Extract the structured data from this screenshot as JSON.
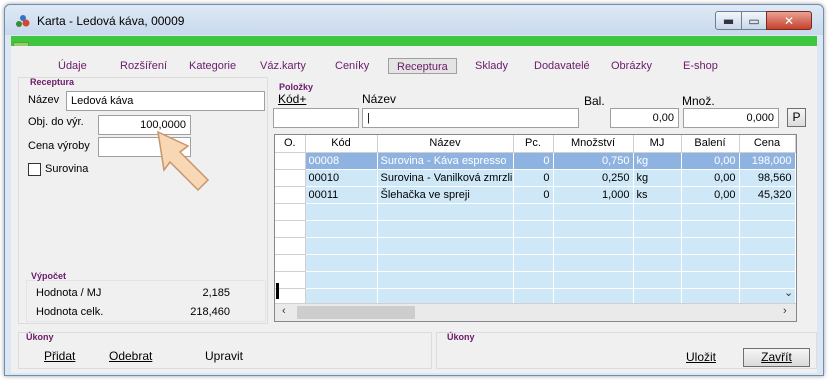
{
  "window": {
    "title": "Karta - Ledová káva, 00009"
  },
  "help_label": "?",
  "tabs": [
    {
      "label": "Údaje"
    },
    {
      "label": "Rozšíření"
    },
    {
      "label": "Kategorie"
    },
    {
      "label": "Váz.karty"
    },
    {
      "label": "Ceníky"
    },
    {
      "label": "Receptura"
    },
    {
      "label": "Sklady"
    },
    {
      "label": "Dodavatelé"
    },
    {
      "label": "Obrázky"
    },
    {
      "label": "E-shop"
    }
  ],
  "receptura": {
    "group_title": "Receptura",
    "nazev_label": "Název",
    "nazev_value": "Ledová káva",
    "obj_label": "Obj. do výr.",
    "obj_value": "100,0000",
    "cena_label": "Cena výroby",
    "cena_value": "",
    "surovina_label": "Surovina"
  },
  "vypocet": {
    "title": "Výpočet",
    "hodnota_mj_label": "Hodnota / MJ",
    "hodnota_mj_value": "2,185",
    "hodnota_celk_label": "Hodnota celk.",
    "hodnota_celk_value": "218,460"
  },
  "polozky": {
    "title": "Položky",
    "kod_label": "Kód+",
    "nazev_label": "Název",
    "bal_label": "Bal.",
    "mnoz_label": "Množ.",
    "kod_value": "",
    "nazev_value": "|",
    "bal_value": "0,00",
    "mnoz_value": "0,000",
    "p_button": "P"
  },
  "grid": {
    "columns": [
      "O.",
      "Kód",
      "Název",
      "Pc.",
      "Množství",
      "MJ",
      "Balení",
      "Cena"
    ],
    "rows": [
      {
        "o": "",
        "kod": "00008",
        "nazev": "Surovina - Káva espresso",
        "pc": "0",
        "mnozstvi": "0,750",
        "mj": "kg",
        "baleni": "0,00",
        "cena": "198,000"
      },
      {
        "o": "",
        "kod": "00010",
        "nazev": "Surovina - Vanilková zmrzlina",
        "pc": "0",
        "mnozstvi": "0,250",
        "mj": "kg",
        "baleni": "0,00",
        "cena": "98,560"
      },
      {
        "o": "",
        "kod": "00011",
        "nazev": "Šlehačka ve spreji",
        "pc": "0",
        "mnozstvi": "1,000",
        "mj": "ks",
        "baleni": "0,00",
        "cena": "45,320"
      }
    ]
  },
  "ukony_left": {
    "title": "Úkony",
    "pridat": "Přidat",
    "odebrat": "Odebrat",
    "upravit": "Upravit"
  },
  "ukony_right": {
    "title": "Úkony",
    "ulozit": "Uložit",
    "zavrit": "Zavřít"
  }
}
